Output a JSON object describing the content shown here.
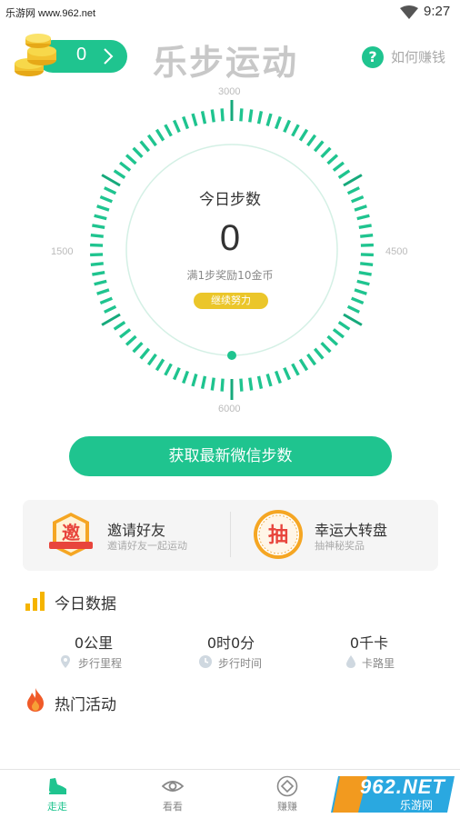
{
  "status_bar": {
    "watermark": "乐游网 www.962.net",
    "time": "9:27"
  },
  "header": {
    "coin_count": "0",
    "app_title": "乐步运动",
    "help_label": "如何赚钱"
  },
  "dial": {
    "tick_labels": {
      "top": "3000",
      "left": "1500",
      "right": "4500",
      "bottom": "6000"
    },
    "title": "今日步数",
    "steps": "0",
    "reward_rule": "满1步奖励10金币",
    "badge": "继续努力"
  },
  "main_button": {
    "label": "获取最新微信步数"
  },
  "promos": {
    "invite": {
      "title": "邀请好友",
      "subtitle": "邀请好友一起运动",
      "icon_char": "邀"
    },
    "wheel": {
      "title": "幸运大转盘",
      "subtitle": "抽神秘奖品",
      "icon_char": "抽"
    }
  },
  "today_data": {
    "title": "今日数据",
    "stats": [
      {
        "value": "0公里",
        "label": "步行里程",
        "icon": "location-icon"
      },
      {
        "value": "0时0分",
        "label": "步行时间",
        "icon": "clock-icon"
      },
      {
        "value": "0千卡",
        "label": "卡路里",
        "icon": "drop-icon"
      }
    ]
  },
  "hot": {
    "title": "热门活动"
  },
  "nav": {
    "items": [
      {
        "label": "走走",
        "icon": "shoe-icon"
      },
      {
        "label": "看看",
        "icon": "eye-icon"
      },
      {
        "label": "赚赚",
        "icon": "diamond-icon"
      }
    ]
  },
  "site_logo": {
    "text": "962.NET",
    "sub": "乐游网"
  },
  "colors": {
    "accent": "#1fc48f",
    "badge": "#ebc62a",
    "title_grey": "#c8c8c8"
  }
}
